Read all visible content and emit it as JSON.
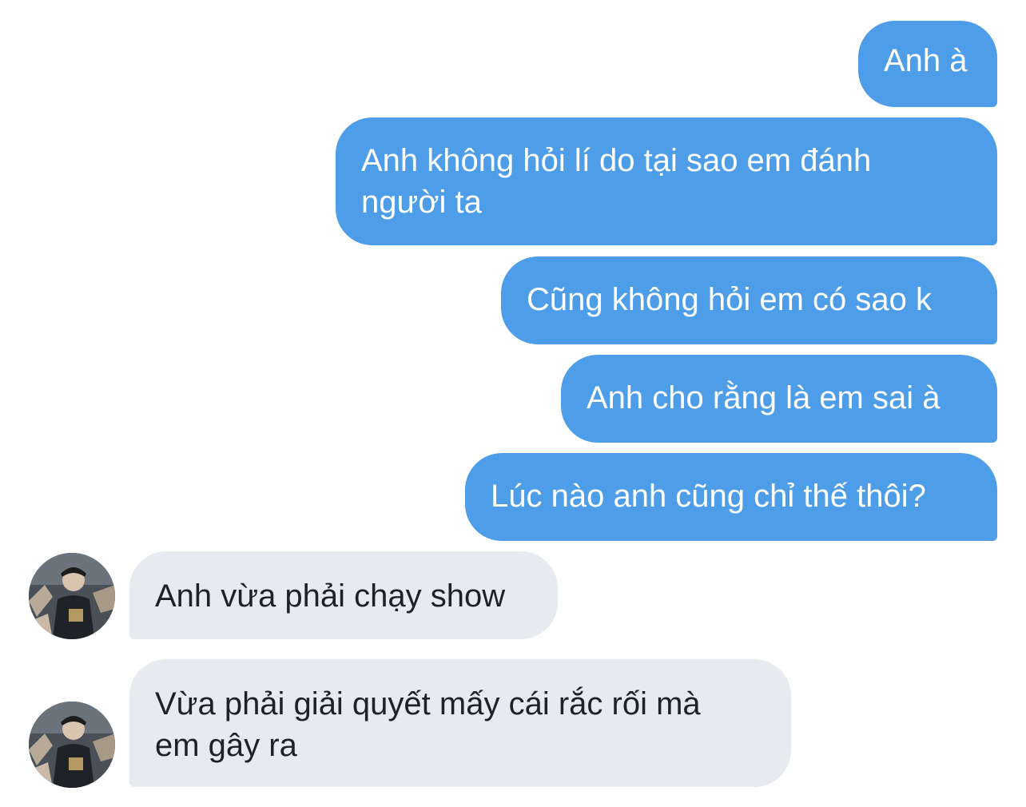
{
  "messages": {
    "outgoing": [
      {
        "text": "Anh à"
      },
      {
        "text": "Anh không hỏi lí do tại sao em đánh\nngười ta"
      },
      {
        "text": "Cũng không hỏi em có sao k"
      },
      {
        "text": "Anh cho rằng là em sai à"
      },
      {
        "text": "Lúc nào anh cũng chỉ thế thôi?"
      }
    ],
    "incoming": [
      {
        "text": "Anh vừa phải chạy show",
        "avatar": "contact-avatar-photo"
      },
      {
        "text": "Vừa phải giải quyết mấy cái rắc rối mà\nem gây ra",
        "avatar": "contact-avatar-photo"
      }
    ]
  },
  "colors": {
    "outgoing_bubble": "#4d9de8",
    "incoming_bubble": "#e7ebef",
    "outgoing_text": "#ffffff",
    "incoming_text": "#1e2226",
    "background": "#ffffff"
  }
}
